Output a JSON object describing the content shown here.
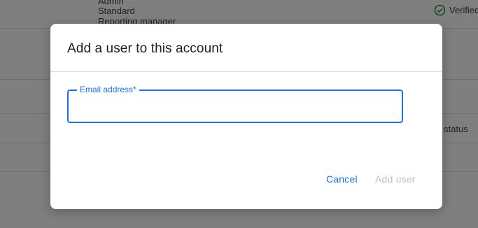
{
  "background": {
    "roles": [
      "Admin",
      "Standard",
      "Reporting manager"
    ],
    "verified_label": "Verified",
    "status_label": "status"
  },
  "dialog": {
    "title": "Add a user to this account",
    "email_label": "Email address*",
    "email_value": "",
    "cancel_label": "Cancel",
    "add_label": "Add user"
  },
  "colors": {
    "accent": "#1a73e8",
    "disabled": "#bdc1c6",
    "verified_icon": "#188038"
  }
}
